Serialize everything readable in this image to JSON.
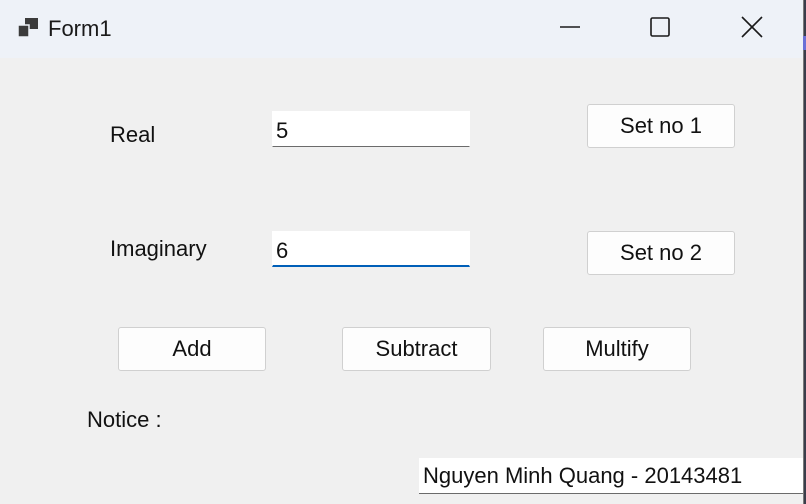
{
  "window": {
    "title": "Form1",
    "controls": {
      "minimize_icon": "minimize-icon",
      "maximize_icon": "maximize-icon",
      "close_icon": "close-icon"
    }
  },
  "form": {
    "real_label": "Real",
    "real_value": "5",
    "imaginary_label": "Imaginary",
    "imaginary_value": "6",
    "set_no1_label": "Set no 1",
    "set_no2_label": "Set no 2",
    "add_label": "Add",
    "subtract_label": "Subtract",
    "multiply_label": "Multify",
    "notice_label": "Notice :",
    "author_text": "Nguyen Minh Quang - 20143481"
  },
  "colors": {
    "focus_accent": "#005fb8",
    "window_bg": "#f0f0f0",
    "titlebar_bg": "#eef2f8"
  }
}
